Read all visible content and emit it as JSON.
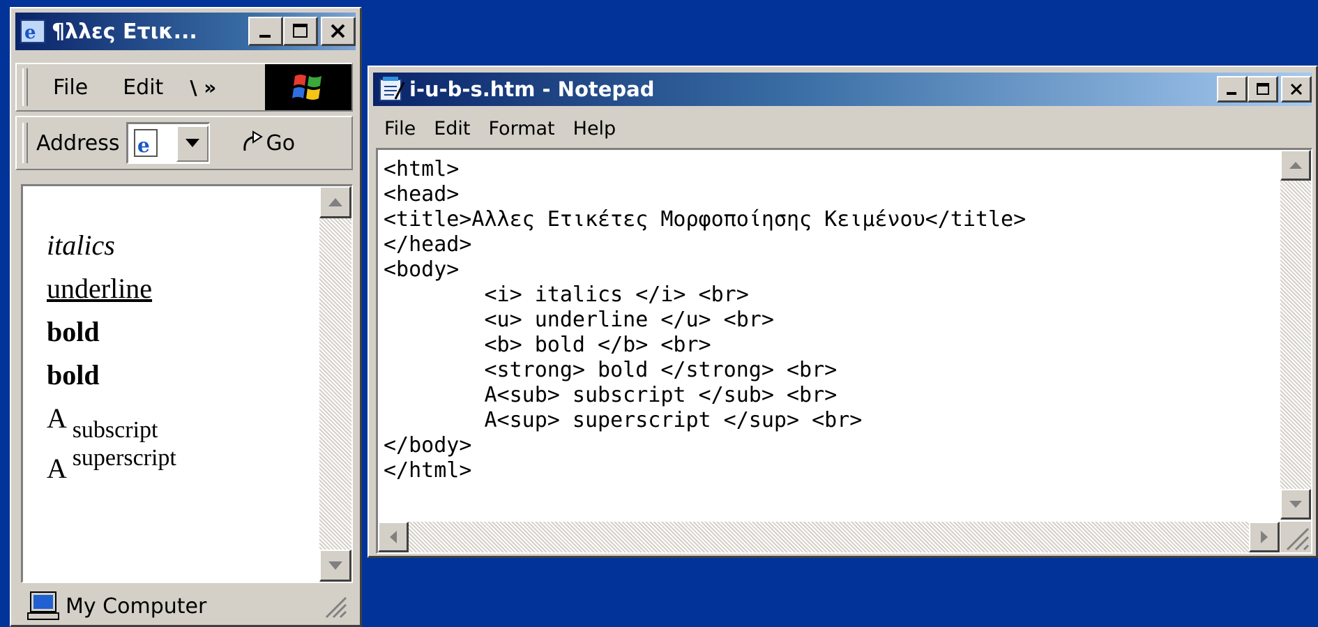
{
  "ie_window": {
    "title": "¶λλες Ετικ...",
    "menu": {
      "file": "File",
      "edit": "Edit",
      "more": "\\ »"
    },
    "address_label": "Address",
    "go_label": "Go",
    "content": {
      "italics": "italics",
      "underline": "underline",
      "bold1": "bold",
      "bold2": "bold",
      "sub_base": "A",
      "sub_text": "subscript",
      "sup_base": "A",
      "sup_text": "superscript"
    },
    "status_text": "My Computer"
  },
  "notepad": {
    "title": "i-u-b-s.htm - Notepad",
    "menu": [
      "File",
      "Edit",
      "Format",
      "Help"
    ],
    "code_lines": [
      "<html>",
      "<head>",
      "<title>Αλλες Ετικέτες Μορφοποίησης Κειμένου</title>",
      "</head>",
      "<body>",
      "        <i> italics </i> <br>",
      "        <u> underline </u> <br>",
      "        <b> bold </b> <br>",
      "        <strong> bold </strong> <br>",
      "        A<sub> subscript </sub> <br>",
      "        A<sup> superscript </sup> <br>",
      "</body>",
      "</html>"
    ]
  },
  "icons": {
    "ie_title": "ie-icon",
    "windows_logo": "windows-logo-icon",
    "page": "page-icon",
    "go": "go-arrow-icon",
    "notepad_title": "notepad-icon",
    "computer": "computer-icon"
  },
  "colors": {
    "desktop": "#013399",
    "titlebar_start": "#0a246a",
    "titlebar_end": "#a6caf0",
    "face": "#d4d0c8"
  }
}
